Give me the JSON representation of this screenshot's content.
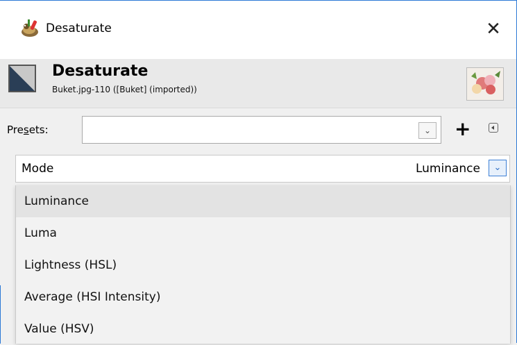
{
  "window": {
    "title": "Desaturate",
    "close_glyph": "✕"
  },
  "header": {
    "title": "Desaturate",
    "subtitle": "Buket.jpg-110 ([Buket] (imported))"
  },
  "presets": {
    "label_prefix": "Pre",
    "label_mnemonic": "s",
    "label_suffix": "ets:",
    "value": "",
    "dropdown_glyph": "⌄",
    "add_glyph": "+"
  },
  "mode": {
    "label": "Mode",
    "value": "Luminance",
    "dropdown_glyph": "⌄",
    "options": [
      "Luminance",
      "Luma",
      "Lightness (HSL)",
      "Average (HSI Intensity)",
      "Value (HSV)"
    ],
    "selected_index": 0
  },
  "colors": {
    "accent": "#2b79d6"
  }
}
